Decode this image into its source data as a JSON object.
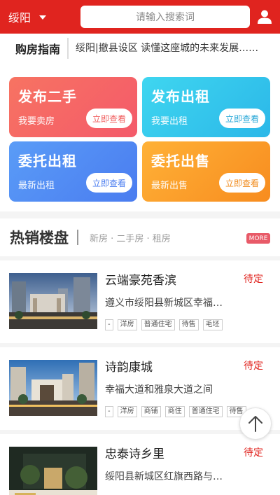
{
  "header": {
    "city": "绥阳",
    "search_placeholder": "请输入搜索词",
    "user_icon": "user-icon",
    "brand_color": "#e0241f"
  },
  "guide": {
    "title": "购房指南",
    "headline": "绥阳|撤县设区 读懂这座城的未来发展……"
  },
  "tiles": [
    {
      "title": "发布二手",
      "subtitle": "我要卖房",
      "button": "立即查看"
    },
    {
      "title": "发布出租",
      "subtitle": "我要出租",
      "button": "立即查看"
    },
    {
      "title": "委托出租",
      "subtitle": "最新出租",
      "button": "立即查看"
    },
    {
      "title": "委托出售",
      "subtitle": "最新出售",
      "button": "立即查看"
    }
  ],
  "hot": {
    "title": "热销楼盘",
    "categories": "新房 · 二手房 · 租房",
    "more": "MORE"
  },
  "listings": [
    {
      "name": "云端豪苑香滨",
      "price": "待定",
      "address": "遵义市绥阳县新城区幸福大道",
      "tags": [
        "-",
        "洋房",
        "普通住宅",
        "待售",
        "毛坯"
      ]
    },
    {
      "name": "诗韵康城",
      "price": "待定",
      "address": "幸福大道和雅泉大道之间",
      "tags": [
        "-",
        "洋房",
        "商铺",
        "商住",
        "普通住宅",
        "待售"
      ]
    },
    {
      "name": "忠泰诗乡里",
      "price": "待定",
      "address": "绥阳县新城区红旗西路与幸福大道",
      "tags": []
    }
  ],
  "scroll_top_icon": "arrow-up-icon"
}
